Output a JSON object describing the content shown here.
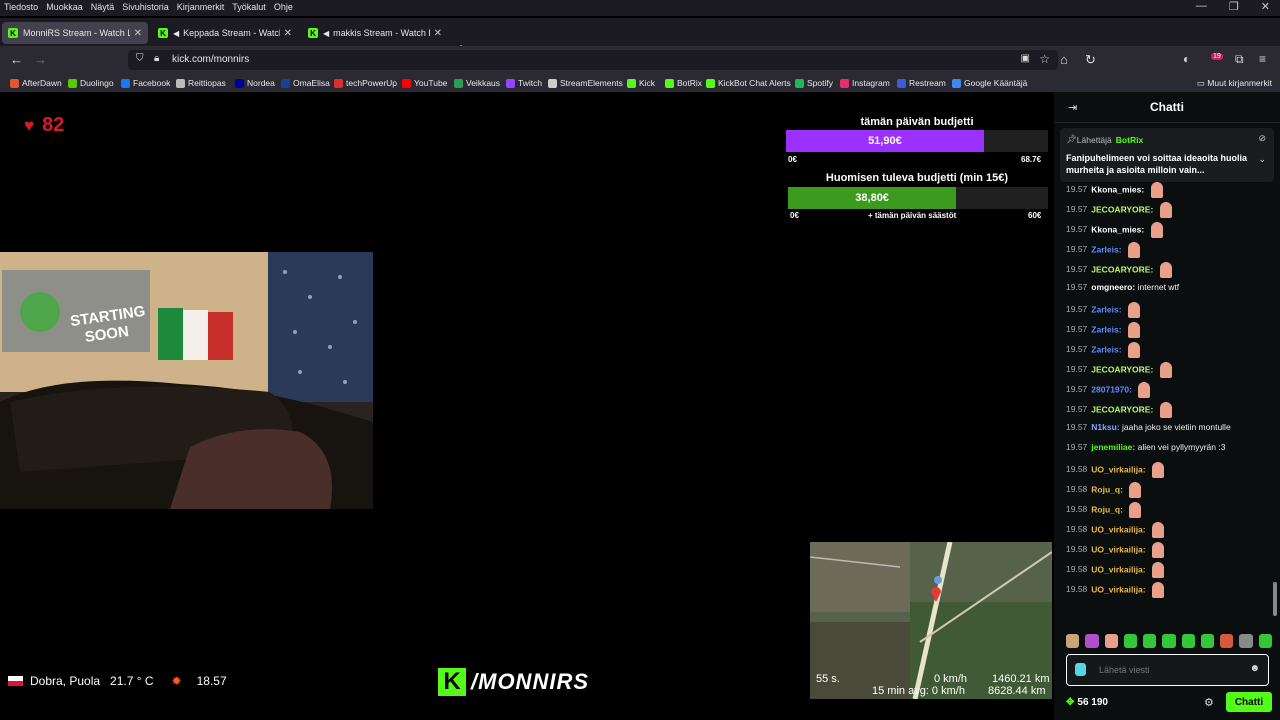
{
  "menubar": {
    "items": [
      "Tiedosto",
      "Muokkaa",
      "Näytä",
      "Sivuhistoria",
      "Kirjanmerkit",
      "Työkalut",
      "Ohje"
    ]
  },
  "tabs": [
    {
      "title": "MonniRS Stream - Watch Live o",
      "active": true
    },
    {
      "title": "Keppada Stream - Watch Li",
      "active": false
    },
    {
      "title": "makkis Stream - Watch Live",
      "active": false
    }
  ],
  "address": {
    "url": "kick.com/monnirs"
  },
  "extensions": {
    "badge": "19"
  },
  "bookmarks": [
    {
      "label": "AfterDawn",
      "color": "#e4572e"
    },
    {
      "label": "Duolingo",
      "color": "#58cc02"
    },
    {
      "label": "Facebook",
      "color": "#1877f2"
    },
    {
      "label": "Reittiopas",
      "color": "#bbbbbb"
    },
    {
      "label": "Nordea",
      "color": "#0000a0"
    },
    {
      "label": "OmaElisa",
      "color": "#1c3f94"
    },
    {
      "label": "techPowerUp",
      "color": "#d63031"
    },
    {
      "label": "YouTube",
      "color": "#ff0000"
    },
    {
      "label": "Veikkaus",
      "color": "#2a9d4e"
    },
    {
      "label": "Twitch",
      "color": "#9146ff"
    },
    {
      "label": "StreamElements",
      "color": "#cccccc"
    },
    {
      "label": "Kick",
      "color": "#53fc18"
    },
    {
      "label": "BotRix",
      "color": "#53fc18"
    },
    {
      "label": "KickBot Chat Alerts",
      "color": "#53fc18"
    },
    {
      "label": "Spotify",
      "color": "#1db954"
    },
    {
      "label": "Instagram",
      "color": "#e1306c"
    },
    {
      "label": "Restream",
      "color": "#3c5bd8"
    },
    {
      "label": "Google Kääntäjä",
      "color": "#4285f4"
    }
  ],
  "other_bookmarks": "Muut kirjanmerkit",
  "stream": {
    "heart_count": "82",
    "budget_today": {
      "title": "tämän päivän budjetti",
      "value": "51,90€",
      "min": "0€",
      "max": "68.7€",
      "fill_fraction": 0.755
    },
    "budget_tomorrow": {
      "title": "Huomisen tuleva budjetti (min 15€)",
      "value": "38,80€",
      "min": "0€",
      "note": "+ tämän päivän säästöt",
      "max": "60€",
      "fill_fraction": 0.647
    },
    "location": "Dobra, Puola",
    "temperature": "21.7 ° C",
    "time": "18.57",
    "channel": "/MONNIRS",
    "map": {
      "refresh": "55 s.",
      "speed": "0 km/h",
      "distance": "1460.21 km",
      "avg_label": "15 min avg: 0 km/h",
      "total": "8628.44 km"
    }
  },
  "chat": {
    "title": "Chatti",
    "pinned": {
      "sender_label": "Lähettäjä",
      "sender": "BotRix",
      "message": "Fanipuhelimeen voi soittaa ideaoita huolia murheita ja asioita milloin vain..."
    },
    "messages": [
      {
        "time": "19.57",
        "user": "Kkona_mies",
        "color": "#ffffff",
        "text": ""
      },
      {
        "time": "19.57",
        "user": "JECOARYORE",
        "color": "#b5f76b",
        "text": ""
      },
      {
        "time": "19.57",
        "user": "Kkona_mies",
        "color": "#ffffff",
        "text": ""
      },
      {
        "time": "19.57",
        "user": "Zarleis",
        "color": "#5b8cff",
        "text": ""
      },
      {
        "time": "19.57",
        "user": "JECOARYORE",
        "color": "#b5f76b",
        "text": ""
      },
      {
        "time": "19.57",
        "user": "omgneero",
        "color": "#ffffff",
        "text": "internet wtf"
      },
      {
        "time": "19.57",
        "user": "Zarleis",
        "color": "#5b8cff",
        "text": ""
      },
      {
        "time": "19.57",
        "user": "Zarleis",
        "color": "#5b8cff",
        "text": ""
      },
      {
        "time": "19.57",
        "user": "Zarleis",
        "color": "#5b8cff",
        "text": ""
      },
      {
        "time": "19.57",
        "user": "JECOARYORE",
        "color": "#b5f76b",
        "text": ""
      },
      {
        "time": "19.57",
        "user": "28071970",
        "color": "#5b8cff",
        "text": ""
      },
      {
        "time": "19.57",
        "user": "JECOARYORE",
        "color": "#b5f76b",
        "text": ""
      },
      {
        "time": "19.57",
        "user": "N1ksu",
        "color": "#7aa7ff",
        "text": "jaaha joko se vietiin montulle"
      },
      {
        "time": "19.57",
        "user": "jenemiliae",
        "color": "#53fc18",
        "text": "alien vei pyllymyyrän :3"
      },
      {
        "time": "19.58",
        "user": "UO_virkailija",
        "color": "#e8b84a",
        "text": ""
      },
      {
        "time": "19.58",
        "user": "Roju_q",
        "color": "#e8b84a",
        "text": ""
      },
      {
        "time": "19.58",
        "user": "Roju_q",
        "color": "#e8b84a",
        "text": ""
      },
      {
        "time": "19.58",
        "user": "UO_virkailija",
        "color": "#e8b84a",
        "text": ""
      },
      {
        "time": "19.58",
        "user": "UO_virkailija",
        "color": "#e8b84a",
        "text": ""
      },
      {
        "time": "19.58",
        "user": "UO_virkailija",
        "color": "#e8b84a",
        "text": ""
      },
      {
        "time": "19.58",
        "user": "UO_virkailija",
        "color": "#e8b84a",
        "text": ""
      }
    ],
    "input_placeholder": "Lähetä viesti",
    "points": "56 190",
    "send_label": "Chatti"
  }
}
